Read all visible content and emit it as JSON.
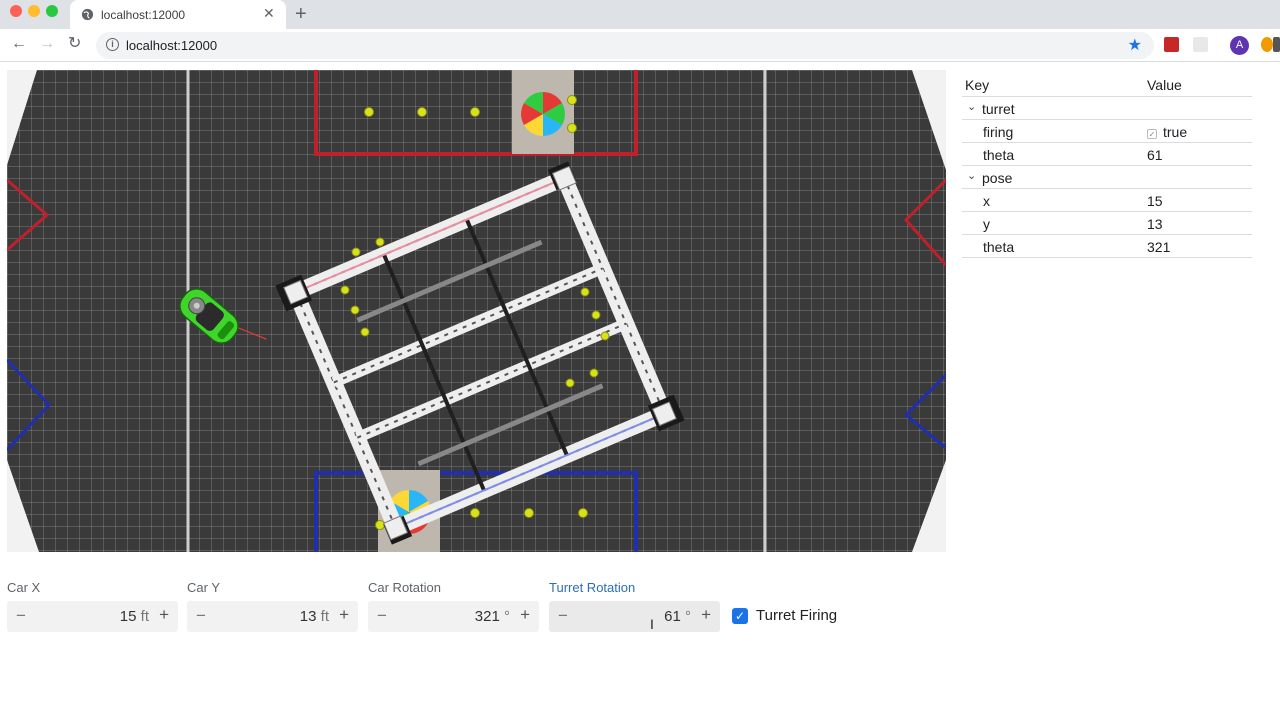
{
  "browser": {
    "tab_title": "localhost:12000",
    "url": "localhost:12000",
    "avatar_initial": "A"
  },
  "telemetry": {
    "header_key": "Key",
    "header_value": "Value",
    "groups": [
      {
        "name": "turret",
        "entries": [
          {
            "key": "firing",
            "value": "true"
          },
          {
            "key": "theta",
            "value": "61"
          }
        ]
      },
      {
        "name": "pose",
        "entries": [
          {
            "key": "x",
            "value": "15"
          },
          {
            "key": "y",
            "value": "13"
          },
          {
            "key": "theta",
            "value": "321"
          }
        ]
      }
    ]
  },
  "controls": {
    "car_x": {
      "label": "Car X",
      "value": "15",
      "unit": "ft"
    },
    "car_y": {
      "label": "Car Y",
      "value": "13",
      "unit": "ft"
    },
    "car_rotation": {
      "label": "Car Rotation",
      "value": "321",
      "unit": "°"
    },
    "turret_rotation": {
      "label": "Turret Rotation",
      "value": "61",
      "unit": "°"
    },
    "turret_firing": {
      "label": "Turret Firing",
      "checked": true
    }
  },
  "colors": {
    "field_bg": "#3a3a3a",
    "red_alliance": "#c0202c",
    "blue_alliance": "#1f2fb0",
    "car": "#3fd62b",
    "ball": "#d8e21a",
    "accent": "#1a73e8"
  }
}
